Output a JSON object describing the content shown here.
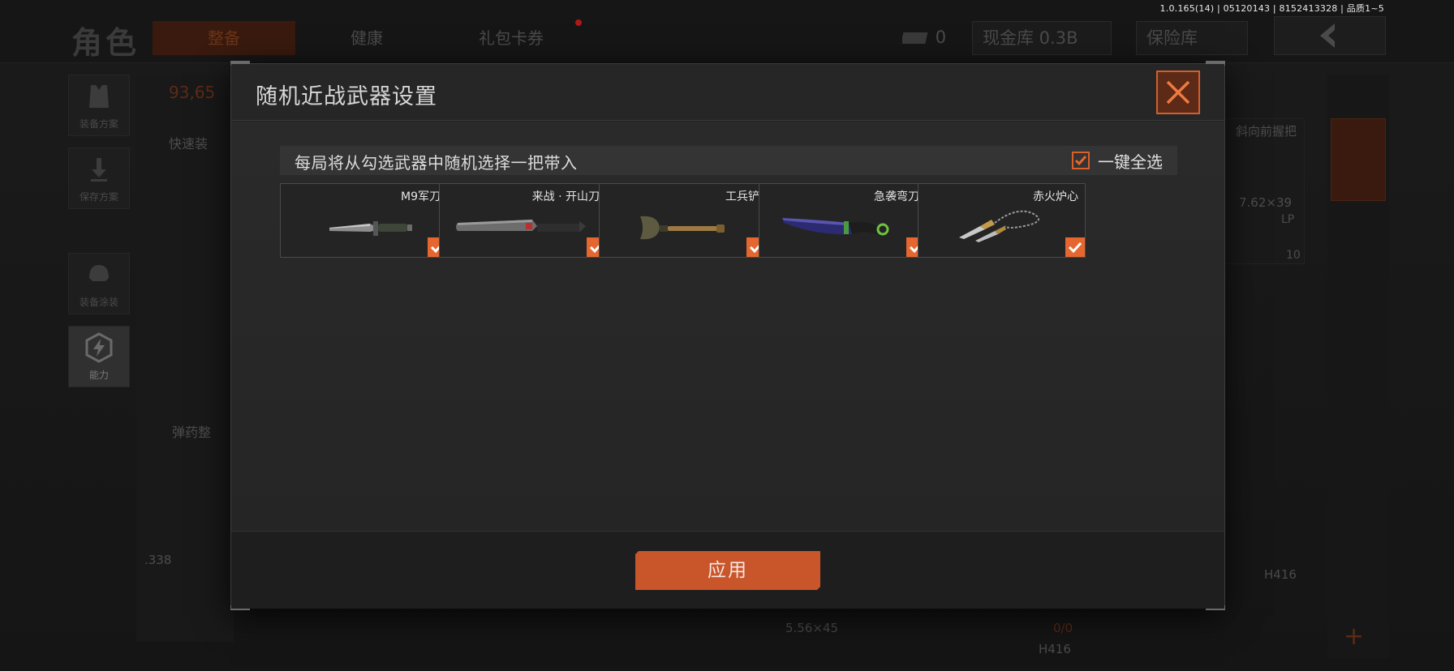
{
  "version_info": "1.0.165(14) | 05120143 | 8152413328 | 品质1~5",
  "background": {
    "page_title": "角色",
    "tabs": [
      {
        "label": "整备"
      },
      {
        "label": "健康"
      },
      {
        "label": "礼包卡券"
      }
    ],
    "currency": {
      "tickets": "0",
      "cash_vault": "现金库 0.3B",
      "safe": "保险库"
    },
    "side_buttons": [
      {
        "label": "装备方案"
      },
      {
        "label": "保存方案"
      },
      {
        "label": "装备涂装"
      },
      {
        "label": "能力"
      }
    ],
    "fragments": {
      "money": "93,65",
      "quick_equip": "快速装",
      "ammo": "弹药整",
      "caliber_338": ".338",
      "grip": "斜向前握把",
      "caliber_762": "7.62×39",
      "lp": "LP",
      "count": "10",
      "h416_a": "H416",
      "caliber_556": "5.56×45",
      "ratio": "0/0",
      "h416_b": "H416"
    }
  },
  "modal": {
    "title": "随机近战武器设置",
    "hint": "每局将从勾选武器中随机选择一把带入",
    "select_all_label": "一键全选",
    "select_all_checked": true,
    "apply_label": "应用",
    "weapons": [
      {
        "name": "M9军刀",
        "checked": true,
        "icon": "bayonet-knife-icon"
      },
      {
        "name": "来战 · 开山刀",
        "checked": true,
        "icon": "machete-icon"
      },
      {
        "name": "工兵铲",
        "checked": true,
        "icon": "shovel-icon"
      },
      {
        "name": "急袭弯刀",
        "checked": true,
        "icon": "karambit-icon"
      },
      {
        "name": "赤火炉心",
        "checked": true,
        "icon": "chain-dagger-icon"
      }
    ]
  },
  "colors": {
    "accent": "#e5672f",
    "close_bg": "#5c2a16",
    "apply_bg": "#c9552b"
  }
}
